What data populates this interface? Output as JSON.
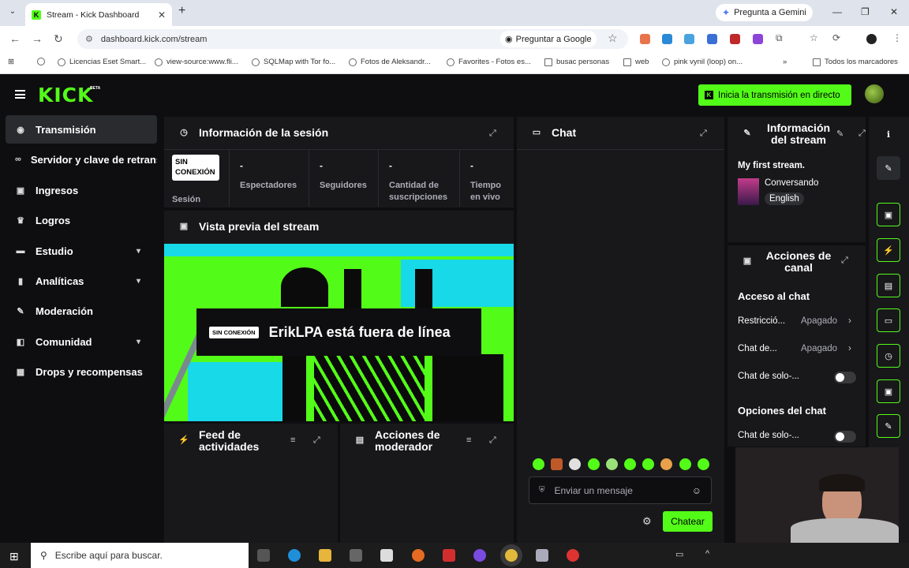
{
  "browser": {
    "tab_title": "Stream - Kick Dashboard",
    "gemini": "Pregunta a Gemini",
    "url": "dashboard.kick.com/stream",
    "ask_google": "Preguntar a Google",
    "bookmarks": [
      "Licencias Eset Smart...",
      "view-source:www.fli...",
      "SQLMap with Tor fo...",
      "Fotos de Aleksandr...",
      "Favorites - Fotos es...",
      "busac personas",
      "web",
      "pink vynil (loop) on..."
    ],
    "all_bookmarks": "Todos los marcadores"
  },
  "header": {
    "logo": "KICK",
    "beta": "BETA",
    "go_live": "Inicia la transmisión en directo"
  },
  "sidebar": {
    "items": [
      {
        "label": "Transmisión",
        "icon": "broadcast-icon"
      },
      {
        "label": "Servidor y clave de retransmisión",
        "icon": "link-icon"
      },
      {
        "label": "Ingresos",
        "icon": "money-icon"
      },
      {
        "label": "Logros",
        "icon": "trophy-icon"
      },
      {
        "label": "Estudio",
        "icon": "studio-icon"
      },
      {
        "label": "Analíticas",
        "icon": "analytics-icon"
      },
      {
        "label": "Moderación",
        "icon": "wrench-icon"
      },
      {
        "label": "Comunidad",
        "icon": "community-icon"
      },
      {
        "label": "Drops y recompensas",
        "icon": "gift-icon"
      }
    ]
  },
  "session": {
    "title": "Información de la sesión",
    "status_badge": "SIN CONEXIÓN",
    "status_label": "Sesión",
    "stats": [
      {
        "value": "-",
        "label": "Espectadores"
      },
      {
        "value": "-",
        "label": "Seguidores"
      },
      {
        "value": "-",
        "label": "Cantidad de suscripciones"
      },
      {
        "value": "-",
        "label": "Tiempo en vivo"
      }
    ]
  },
  "preview": {
    "title": "Vista previa del stream",
    "badge": "SIN CONEXIÓN",
    "message": "ErikLPA está fuera de línea"
  },
  "activity": {
    "title": "Feed de actividades"
  },
  "modactions": {
    "title": "Acciones de moderador"
  },
  "chat": {
    "title": "Chat",
    "placeholder": "Enviar un mensaje",
    "send_label": "Chatear"
  },
  "stream_info": {
    "title": "Información del stream",
    "stream_title": "My first stream.",
    "category": "Conversando",
    "language": "English"
  },
  "channel_actions": {
    "title": "Acciones de canal",
    "access_section": "Acceso al chat",
    "rows": [
      {
        "label": "Restricció...",
        "value": "Apagado"
      },
      {
        "label": "Chat de...",
        "value": "Apagado"
      }
    ],
    "toggle1_label": "Chat de solo-...",
    "options_section": "Opciones del chat",
    "toggle2_label": "Chat de solo-..."
  },
  "taskbar": {
    "search_placeholder": "Escribe aquí para buscar."
  },
  "colors": {
    "accent": "#53fc18",
    "bg": "#0e0e10",
    "panel": "#18181b"
  }
}
